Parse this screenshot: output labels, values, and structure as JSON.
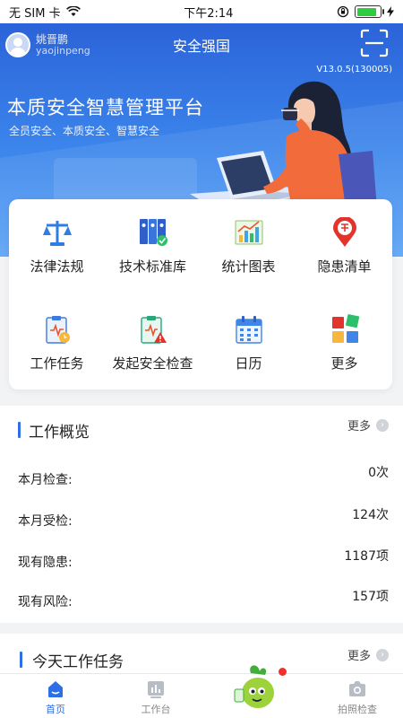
{
  "status_bar": {
    "carrier": "无 SIM 卡",
    "time": "下午2:14",
    "battery_level": 0.85
  },
  "header": {
    "user_name": "姚晋鹏",
    "user_id": "yaojinpeng",
    "title": "安全强国",
    "scan_icon": "scan-icon"
  },
  "banner": {
    "version": "V13.0.5(130005)",
    "title": "本质安全智慧管理平台",
    "subtitle": "全员安全、本质安全、智慧安全"
  },
  "menu": [
    {
      "label": "法律法规",
      "icon": "scale-icon"
    },
    {
      "label": "技术标准库",
      "icon": "binders-icon"
    },
    {
      "label": "统计图表",
      "icon": "bar-chart-icon"
    },
    {
      "label": "隐患清单",
      "icon": "hazard-pin-icon"
    },
    {
      "label": "工作任务",
      "icon": "task-clipboard-icon"
    },
    {
      "label": "发起安全检查",
      "icon": "inspection-alert-icon"
    },
    {
      "label": "日历",
      "icon": "calendar-icon"
    },
    {
      "label": "更多",
      "icon": "more-blocks-icon"
    }
  ],
  "overview": {
    "title": "工作概览",
    "more": "更多",
    "rows": [
      {
        "label": "本月检查:",
        "value": "0次"
      },
      {
        "label": "本月受检:",
        "value": "124次"
      },
      {
        "label": "现有隐患:",
        "value": "1187项"
      },
      {
        "label": "现有风险:",
        "value": "157项"
      }
    ]
  },
  "tasks": {
    "title": "今天工作任务",
    "more": "更多"
  },
  "tabbar": {
    "home": "首页",
    "workbench": "工作台",
    "photo_check": "拍照检查"
  },
  "colors": {
    "brand_blue": "#2f6fe5",
    "hero_top": "#2b63d8",
    "badge_red": "#f0302c"
  }
}
